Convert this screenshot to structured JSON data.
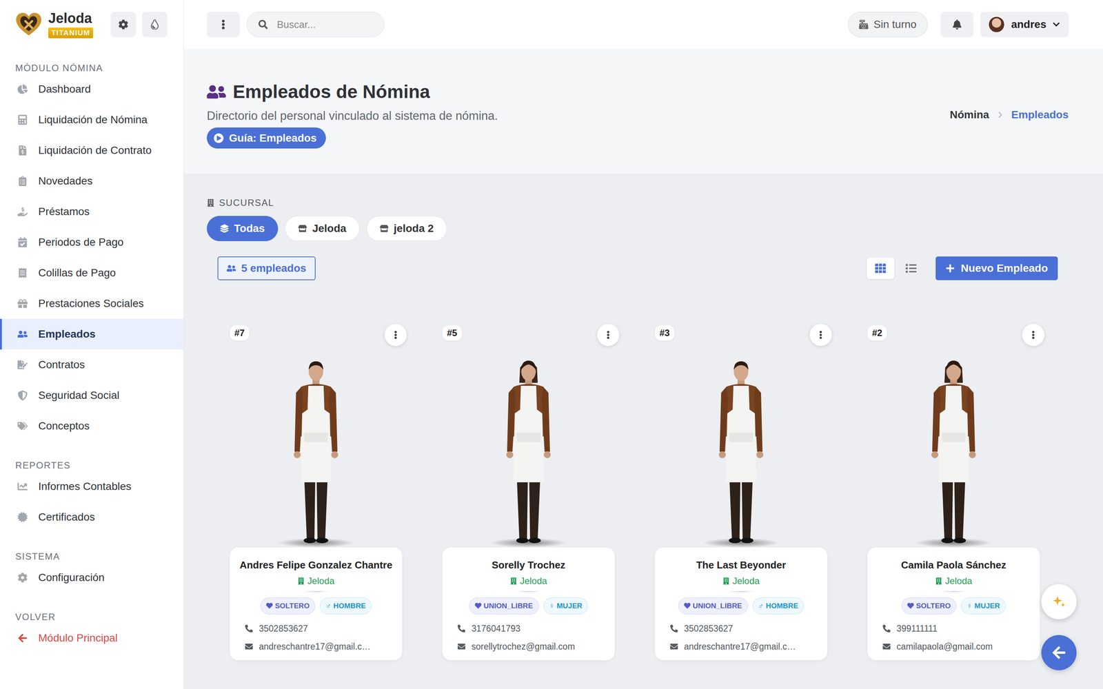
{
  "brand": {
    "name": "Jeloda",
    "badge": "TITANIUM"
  },
  "search": {
    "placeholder": "Buscar..."
  },
  "shift": {
    "label": "Sin turno"
  },
  "user": {
    "name": "andres"
  },
  "sidebar": {
    "sections": [
      {
        "label": "MÓDULO NÓMINA",
        "items": [
          {
            "label": "Dashboard",
            "selected": false,
            "kind": "nav"
          },
          {
            "label": "Liquidación de Nómina",
            "selected": false,
            "kind": "nav"
          },
          {
            "label": "Liquidación de Contrato",
            "selected": false,
            "kind": "nav"
          },
          {
            "label": "Novedades",
            "selected": false,
            "kind": "nav"
          },
          {
            "label": "Préstamos",
            "selected": false,
            "kind": "nav"
          },
          {
            "label": "Periodos de Pago",
            "selected": false,
            "kind": "nav"
          },
          {
            "label": "Colillas de Pago",
            "selected": false,
            "kind": "nav"
          },
          {
            "label": "Prestaciones Sociales",
            "selected": false,
            "kind": "nav"
          },
          {
            "label": "Empleados",
            "selected": true,
            "kind": "nav"
          },
          {
            "label": "Contratos",
            "selected": false,
            "kind": "nav"
          },
          {
            "label": "Seguridad Social",
            "selected": false,
            "kind": "nav"
          },
          {
            "label": "Conceptos",
            "selected": false,
            "kind": "nav"
          }
        ]
      },
      {
        "label": "REPORTES",
        "items": [
          {
            "label": "Informes Contables",
            "selected": false,
            "kind": "nav"
          },
          {
            "label": "Certificados",
            "selected": false,
            "kind": "nav"
          }
        ]
      },
      {
        "label": "SISTEMA",
        "items": [
          {
            "label": "Configuración",
            "selected": false,
            "kind": "nav"
          }
        ]
      },
      {
        "label": "VOLVER",
        "items": [
          {
            "label": "Módulo Principal",
            "selected": false,
            "kind": "back"
          }
        ]
      }
    ]
  },
  "page": {
    "title": "Empleados de Nómina",
    "subtitle": "Directorio del personal vinculado al sistema de nómina.",
    "guide": "Guía: Empleados"
  },
  "breadcrumb": [
    {
      "label": "Nómina",
      "selected": false
    },
    {
      "label": "Empleados",
      "selected": true
    }
  ],
  "branch_filter": {
    "label": "SUCURSAL",
    "options": [
      {
        "label": "Todas",
        "selected": true
      },
      {
        "label": "Jeloda",
        "selected": false
      },
      {
        "label": "jeloda 2",
        "selected": false
      }
    ]
  },
  "count": "5 empleados",
  "view_modes": [
    {
      "name": "grid",
      "selected": true
    },
    {
      "name": "list",
      "selected": false
    }
  ],
  "new_button": "Nuevo Empleado",
  "employees": [
    {
      "number": "#7",
      "name": "Andres Felipe Gonzalez Chantre",
      "branch": "Jeloda",
      "civil_status": "SOLTERO",
      "gender_symbol": "♂",
      "gender": "HOMBRE",
      "phone": "3502853627",
      "email": "andreschantre17@gmail.c…",
      "kind": "man"
    },
    {
      "number": "#5",
      "name": "Sorelly Trochez",
      "branch": "Jeloda",
      "civil_status": "UNION_LIBRE",
      "gender_symbol": "♀",
      "gender": "MUJER",
      "phone": "3176041793",
      "email": "sorellytrochez@gmail.com",
      "kind": "woman"
    },
    {
      "number": "#3",
      "name": "The Last Beyonder",
      "branch": "Jeloda",
      "civil_status": "UNION_LIBRE",
      "gender_symbol": "♂",
      "gender": "HOMBRE",
      "phone": "3502853627",
      "email": "andreschantre17@gmail.c…",
      "kind": "man"
    },
    {
      "number": "#2",
      "name": "Camila Paola Sánchez",
      "branch": "Jeloda",
      "civil_status": "SOLTERO",
      "gender_symbol": "♀",
      "gender": "MUJER",
      "phone": "399111111",
      "email": "camilapaola@gmail.com",
      "kind": "woman"
    }
  ]
}
